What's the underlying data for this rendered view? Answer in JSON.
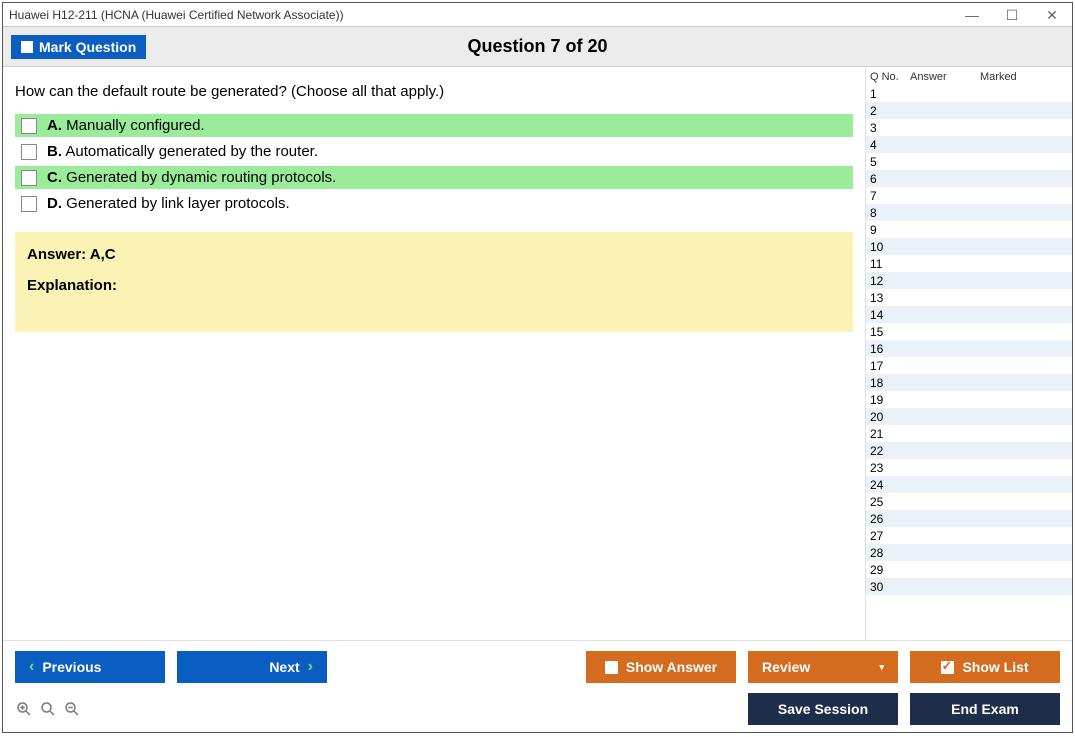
{
  "window": {
    "title": "Huawei H12-211 (HCNA (Huawei Certified Network Associate))"
  },
  "toolbar": {
    "mark_label": "Mark Question",
    "question_heading": "Question 7 of 20"
  },
  "question": {
    "text": "How can the default route be generated? (Choose all that apply.)",
    "options": [
      {
        "letter": "A.",
        "text": "Manually configured.",
        "highlight": true
      },
      {
        "letter": "B.",
        "text": "Automatically generated by the router.",
        "highlight": false
      },
      {
        "letter": "C.",
        "text": "Generated by dynamic routing protocols.",
        "highlight": true
      },
      {
        "letter": "D.",
        "text": "Generated by link layer protocols.",
        "highlight": false
      }
    ]
  },
  "answer_panel": {
    "answer_label": "Answer: A,C",
    "explanation_label": "Explanation:"
  },
  "sidebar": {
    "headers": {
      "qno": "Q No.",
      "answer": "Answer",
      "marked": "Marked"
    },
    "rows": [
      1,
      2,
      3,
      4,
      5,
      6,
      7,
      8,
      9,
      10,
      11,
      12,
      13,
      14,
      15,
      16,
      17,
      18,
      19,
      20,
      21,
      22,
      23,
      24,
      25,
      26,
      27,
      28,
      29,
      30
    ]
  },
  "buttons": {
    "previous": "Previous",
    "next": "Next",
    "show_answer": "Show Answer",
    "review": "Review",
    "show_list": "Show List",
    "save_session": "Save Session",
    "end_exam": "End Exam"
  }
}
